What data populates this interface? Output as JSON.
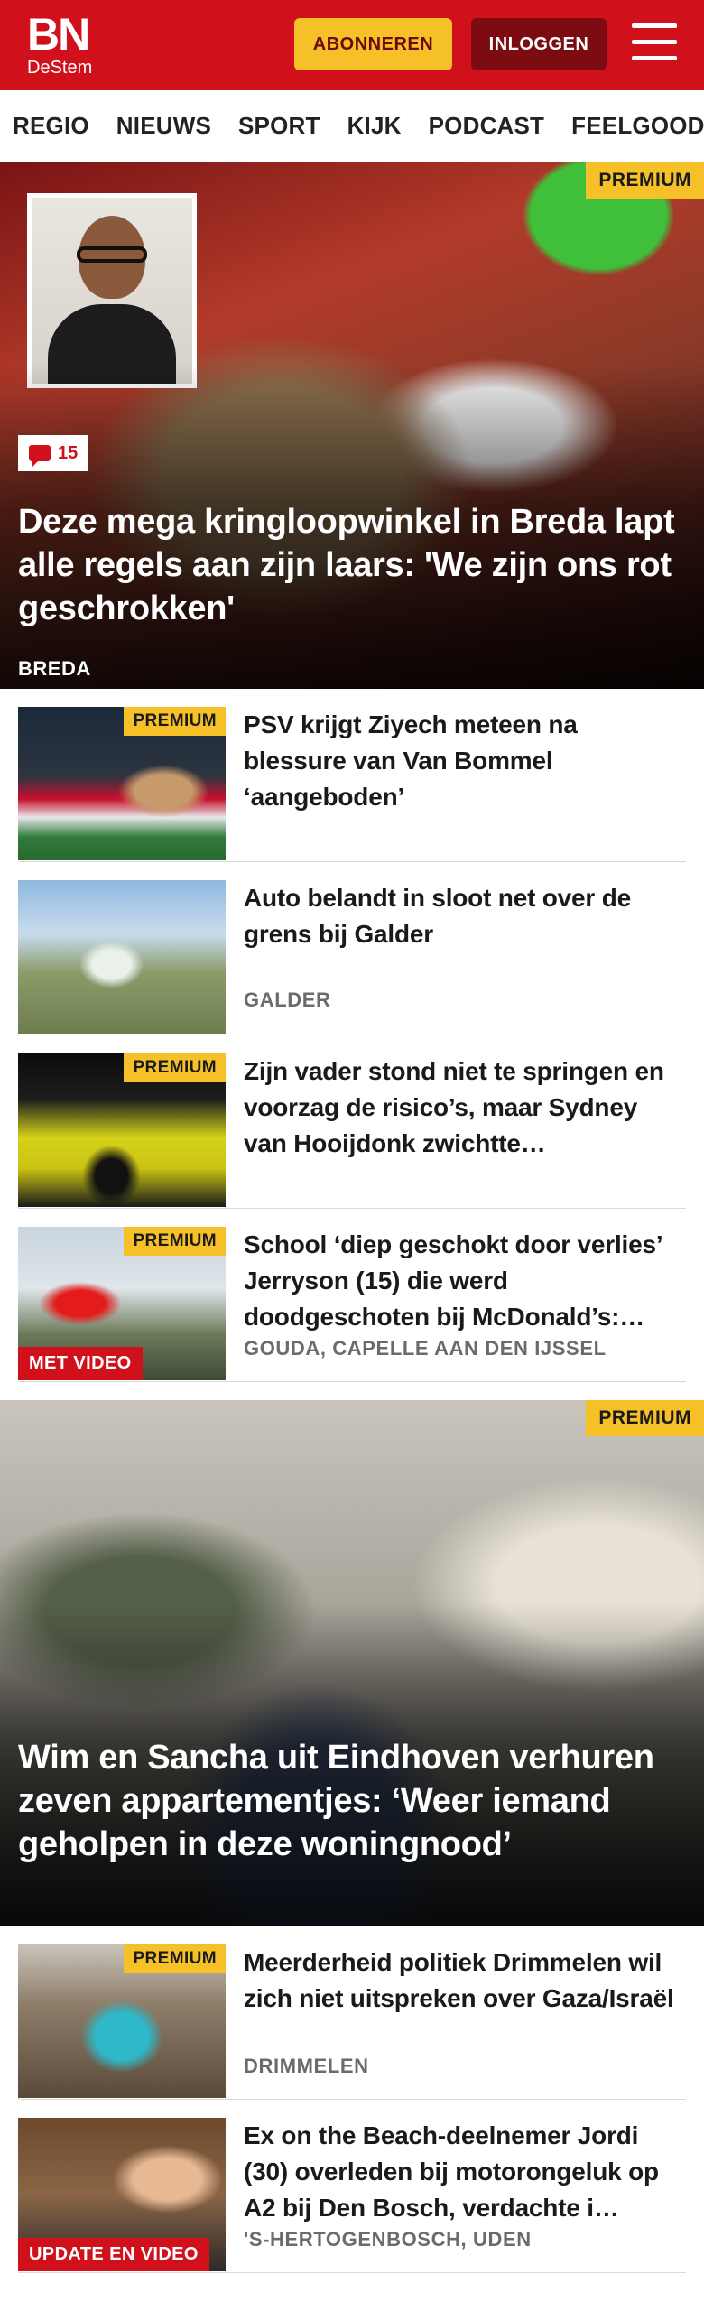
{
  "header": {
    "logo_main": "BN",
    "logo_sub": "DeStem",
    "subscribe_label": "ABONNEREN",
    "login_label": "INLOGGEN",
    "menu_icon": "hamburger-icon",
    "brand_color": "#d0111b",
    "accent_color": "#f6c028"
  },
  "nav": {
    "items": [
      "REGIO",
      "NIEUWS",
      "SPORT",
      "KIJK",
      "PODCAST",
      "FEELGOOD"
    ]
  },
  "hero1": {
    "badge": "PREMIUM",
    "comment_count": "15",
    "title": "Deze mega kringloopwinkel in Breda lapt alle regels aan zijn laars: 'We zijn ons rot geschrokken'",
    "location": "BREDA"
  },
  "articles_a": [
    {
      "badge": "PREMIUM",
      "title": "PSV krijgt Ziyech meteen na blessure van Van Bommel ‘aangeboden’",
      "location": ""
    },
    {
      "badge": "",
      "title": "Auto belandt in sloot net over de grens bij Galder",
      "location": "GALDER"
    },
    {
      "badge": "PREMIUM",
      "title": "Zijn vader stond niet te springen en voorzag de risico’s, maar Sydney van Hooijdonk zwichtte…",
      "location": ""
    },
    {
      "badge": "PREMIUM",
      "video": "MET VIDEO",
      "title": "School ‘diep geschokt door verlies’ Jerryson (15) die werd doodgeschoten bij McDonald’s:…",
      "location": "GOUDA, CAPELLE AAN DEN IJSSEL"
    }
  ],
  "hero2": {
    "badge": "PREMIUM",
    "title": "Wim en Sancha uit Eindhoven verhuren zeven appartementjes: ‘Weer iemand geholpen in deze woningnood’"
  },
  "articles_b": [
    {
      "badge": "PREMIUM",
      "title": "Meerderheid politiek Drimmelen wil zich niet uitspreken over Gaza/Israël",
      "location": "DRIMMELEN"
    },
    {
      "badge": "",
      "video": "UPDATE EN VIDEO",
      "title": "Ex on the Beach-deelnemer Jordi (30) overleden bij motorongeluk op A2 bij Den Bosch, verdachte i…",
      "location": "'S-HERTOGENBOSCH, UDEN"
    }
  ]
}
